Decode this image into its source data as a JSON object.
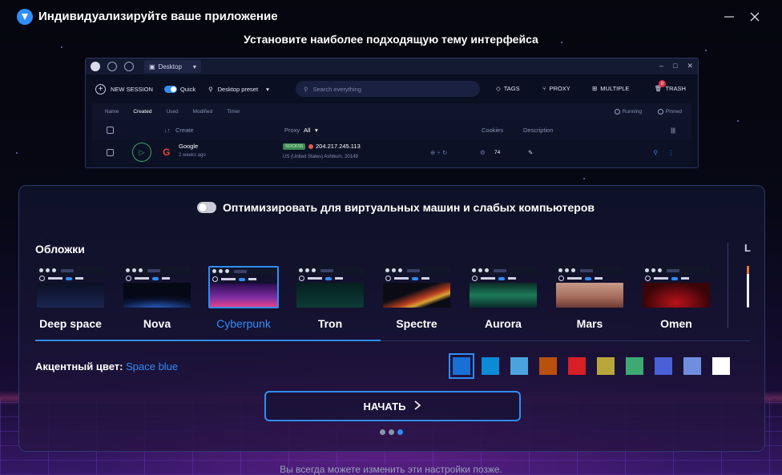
{
  "app": {
    "title": "Индивидуализируйте ваше приложение",
    "subtitle": "Установите наиболее подходящую тему интерфейса"
  },
  "window_controls": {
    "minimize_icon": "minimize-icon",
    "close_icon": "close-icon"
  },
  "preview": {
    "tab_label": "Desktop",
    "window_controls": [
      "–",
      "□",
      "✕"
    ],
    "toolbar": {
      "new_session": "NEW SESSION",
      "quick": "Quick",
      "preset": "Desktop preset",
      "search_placeholder": "Search everything",
      "tags": "TAGS",
      "proxy": "PROXY",
      "multiple": "MULTIPLE",
      "trash": "TRASH",
      "trash_badge": "8"
    },
    "filters": {
      "items": [
        "Name",
        "Created",
        "Used",
        "Modified",
        "Timer"
      ],
      "active": "Created",
      "running": "Running",
      "pinned": "Pinned"
    },
    "columns": {
      "create": "Create",
      "proxy": "Proxy",
      "proxy_filter": "All",
      "cookies": "Cookies",
      "description": "Description"
    },
    "row": {
      "name": "Google",
      "time": "2 weeks ago",
      "proxy_type": "SOCKS5",
      "ip": "204.217.245.113",
      "location": "US (United States) Ashburn, 20149",
      "cookies": "74"
    }
  },
  "optimize": {
    "label": "Оптимизировать для виртуальных машин и слабых компьютеров",
    "enabled": false
  },
  "skins": {
    "title": "Обложки",
    "extra_label": "L",
    "items": [
      {
        "name": "Deep space",
        "selected": false
      },
      {
        "name": "Nova",
        "selected": false
      },
      {
        "name": "Cyberpunk",
        "selected": true
      },
      {
        "name": "Tron",
        "selected": false
      },
      {
        "name": "Spectre",
        "selected": false
      },
      {
        "name": "Aurora",
        "selected": false
      },
      {
        "name": "Mars",
        "selected": false
      },
      {
        "name": "Omen",
        "selected": false
      }
    ]
  },
  "accent": {
    "label": "Акцентный цвет:",
    "value": "Space blue",
    "colors": [
      "#1a6fd6",
      "#0b8ad6",
      "#4aa3de",
      "#b8500e",
      "#d61f26",
      "#b8a63a",
      "#3daa72",
      "#4b5fd6",
      "#6f8ee0",
      "#ffffff"
    ],
    "selected_index": 0
  },
  "start_button": {
    "label": "НАЧАТЬ",
    "icon": "chevron-right-icon"
  },
  "pagination": {
    "total": 3,
    "current": 3
  },
  "footer": {
    "note": "Вы всегда можете изменить эти настройки позже."
  }
}
